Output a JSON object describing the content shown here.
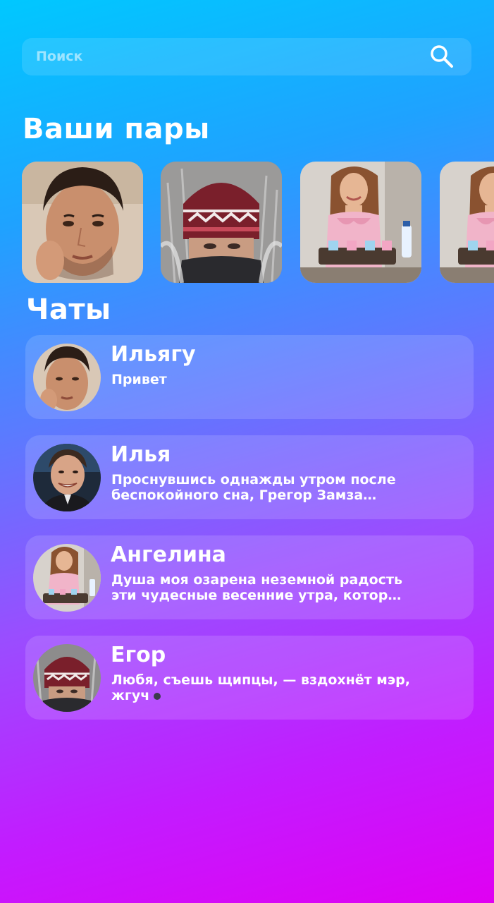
{
  "search": {
    "placeholder": "Поиск",
    "icon": "search-icon"
  },
  "matches": {
    "title": "Ваши пары",
    "items": [
      {
        "photo": "young-man-portrait"
      },
      {
        "photo": "man-in-winter-hat-frost"
      },
      {
        "photo": "woman-in-kitchen-with-tray"
      },
      {
        "photo": "woman-in-kitchen-with-tray"
      }
    ]
  },
  "chats": {
    "title": "Чаты",
    "items": [
      {
        "name": "Ильягу",
        "preview": "Привет",
        "avatar": "young-man-portrait",
        "typing": false
      },
      {
        "name": "Илья",
        "preview": "Проснувшись однажды утром после беспокойного сна, Грегор Замза…",
        "avatar": "smiling-man-in-suit",
        "typing": false
      },
      {
        "name": "Ангелина",
        "preview": "Душа моя озарена неземной радость эти чудесные весенние утра, котор…",
        "avatar": "woman-in-kitchen-with-tray",
        "typing": false
      },
      {
        "name": "Егор",
        "preview": "Любя, съешь щипцы, — вздохнёт мэр, жгуч",
        "avatar": "man-in-winter-hat-frost",
        "typing": true
      }
    ]
  },
  "colors": {
    "gradient_top": "#00c8ff",
    "gradient_bottom": "#e000f2",
    "card_overlay": "rgba(255,255,255,0.14)"
  }
}
